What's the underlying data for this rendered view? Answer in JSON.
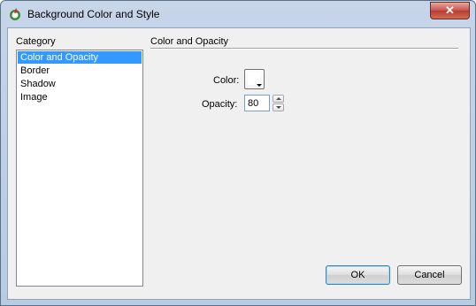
{
  "window": {
    "title": "Background Color and Style",
    "close_label": "✕"
  },
  "category": {
    "label": "Category",
    "items": [
      "Color and Opacity",
      "Border",
      "Shadow",
      "Image"
    ],
    "selected": "Color and Opacity"
  },
  "panel": {
    "title": "Color and Opacity",
    "color_label": "Color:",
    "color_value": "#ffffff",
    "opacity_label": "Opacity:",
    "opacity_value": "80"
  },
  "buttons": {
    "ok": "OK",
    "cancel": "Cancel"
  }
}
